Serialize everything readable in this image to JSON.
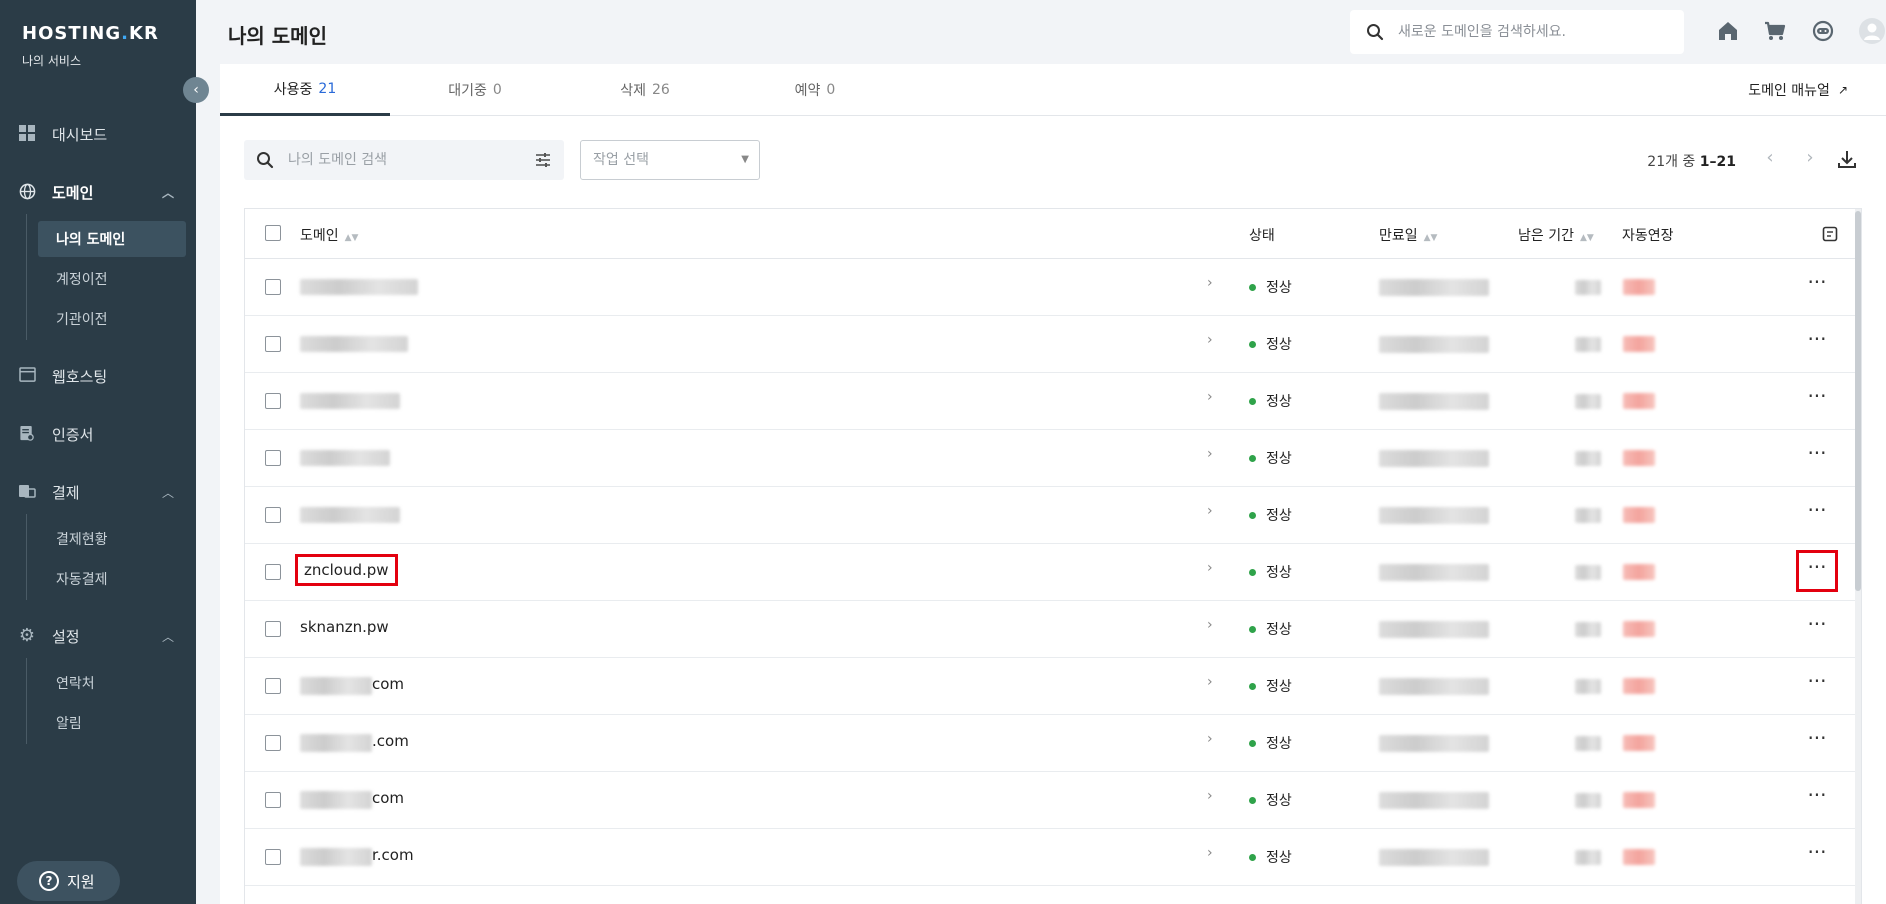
{
  "sidebar": {
    "logo_main": "HOSTING",
    "logo_dot": ".",
    "logo_end": "KR",
    "logo_sub": "나의 서비스",
    "collapse_icon": "chevron-left-icon",
    "items": [
      {
        "label": "대시보드",
        "icon": "dashboard-icon"
      },
      {
        "label": "도메인",
        "icon": "globe-icon"
      },
      {
        "label": "웹호스팅",
        "icon": "window-icon"
      },
      {
        "label": "인증서",
        "icon": "certificate-icon"
      },
      {
        "label": "결제",
        "icon": "payment-icon"
      },
      {
        "label": "설정",
        "icon": "gear-icon"
      }
    ],
    "domain_sub": [
      "나의 도메인",
      "계정이전",
      "기관이전"
    ],
    "payment_sub": [
      "결제현황",
      "자동결제"
    ],
    "settings_sub": [
      "연락처",
      "알림"
    ],
    "support_label": "지원"
  },
  "header": {
    "title": "나의 도메인",
    "search_placeholder": "새로운 도메인을 검색하세요.",
    "icons": [
      "home-icon",
      "cart-icon",
      "chat-icon",
      "user-icon"
    ]
  },
  "tabs": [
    {
      "label": "사용중",
      "count": "21"
    },
    {
      "label": "대기중",
      "count": "0"
    },
    {
      "label": "삭제",
      "count": "26"
    },
    {
      "label": "예약",
      "count": "0"
    }
  ],
  "manual_link": "도메인 매뉴얼",
  "toolbar": {
    "search_placeholder": "나의 도메인 검색",
    "action_placeholder": "작업 선택",
    "pager_prefix": "21개 중 ",
    "pager_range": "1–21"
  },
  "table": {
    "headers": {
      "domain": "도메인",
      "status": "상태",
      "expiry": "만료일",
      "remaining": "남은 기간",
      "autorenew": "자동연장"
    },
    "rows": [
      {
        "name": "",
        "suffix": "",
        "status": "정상"
      },
      {
        "name": "",
        "suffix": "",
        "status": "정상"
      },
      {
        "name": "",
        "suffix": "",
        "status": "정상"
      },
      {
        "name": "",
        "suffix": "",
        "status": "정상"
      },
      {
        "name": "",
        "suffix": "",
        "status": "정상"
      },
      {
        "name": "zncloud.pw",
        "suffix": "",
        "status": "정상"
      },
      {
        "name": "sknanzn.pw",
        "suffix": "",
        "status": "정상"
      },
      {
        "name": "",
        "suffix": "com",
        "status": "정상"
      },
      {
        "name": "",
        "suffix": ".com",
        "status": "정상"
      },
      {
        "name": "",
        "suffix": "com",
        "status": "정상"
      },
      {
        "name": "",
        "suffix": "r.com",
        "status": "정상"
      }
    ]
  },
  "colors": {
    "sidebar_bg": "#2b3c47",
    "status_ok": "#2fa34a",
    "highlight": "#e3000f",
    "tab_count_active": "#2a6ad8"
  }
}
